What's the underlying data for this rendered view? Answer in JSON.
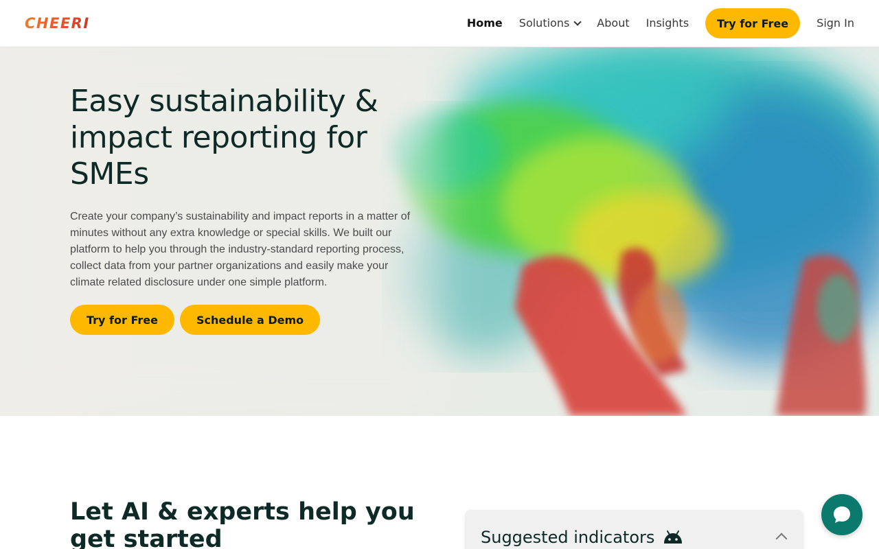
{
  "brand": {
    "logo_text": "CHEERI",
    "accent_color": "#ffb800",
    "teal_color": "#0b7a6c"
  },
  "nav": {
    "home": "Home",
    "solutions": "Solutions",
    "about": "About",
    "insights": "Insights",
    "cta": "Try for Free",
    "sign_in": "Sign In"
  },
  "hero": {
    "title": "Easy sustainability & impact reporting for SMEs",
    "description": "Create your company’s sustainability and impact reports in a matter of minutes without any extra knowledge or special skills. We built our platform to help you through the industry-standard reporting process, collect data from your partner organizations and easily make your climate related disclosure under one simple platform.",
    "primary_button": "Try for Free",
    "secondary_button": "Schedule a Demo"
  },
  "section2": {
    "title": "Let AI & experts help you get started",
    "card_title": "Suggested indicators",
    "card_icon": "android-robot-icon"
  },
  "chat": {
    "icon": "chat-bubble-icon"
  }
}
